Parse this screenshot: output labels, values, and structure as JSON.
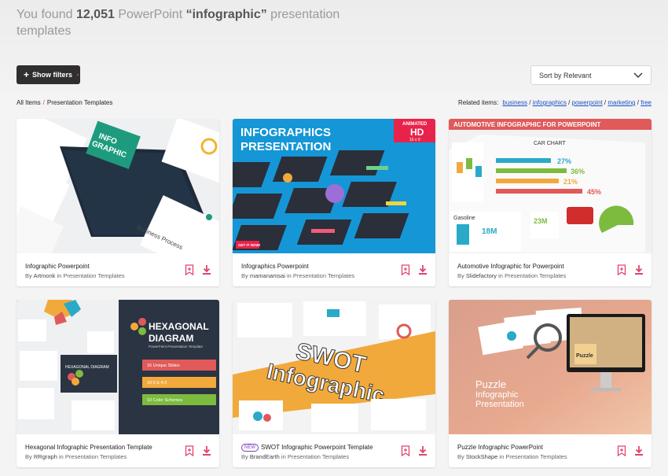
{
  "header": {
    "prefix": "You found",
    "count": "12,051",
    "mid": "PowerPoint",
    "query": "“infographic”",
    "suffix": "presentation templates"
  },
  "toolbar": {
    "filters_label": "Show filters",
    "sort_label": "Sort by Relevant"
  },
  "breadcrumb": {
    "root": "All Items",
    "separator": "/",
    "current": "Presentation Templates"
  },
  "related": {
    "label": "Related items:",
    "items": [
      "business",
      "infographics",
      "powerpoint",
      "marketing",
      "free"
    ],
    "separator": "/"
  },
  "cards": [
    {
      "title": "Infographic Powerpoint",
      "author": "Artmonk",
      "category": "Presentation Templates",
      "thumb_text": [
        "INFO",
        "GRAPHIC",
        "Business Process"
      ]
    },
    {
      "title": "Infographics Powerpoint",
      "author": "mamanamsai",
      "category": "Presentation Templates",
      "thumb_text": [
        "INFOGRAPHICS",
        "PRESENTATION",
        "ANIMATED",
        "HD",
        "16 x 9",
        "GET IT NOW!"
      ]
    },
    {
      "title": "Automotive Infographic for Powerpoint",
      "author": "Slidefactory",
      "category": "Presentation Templates",
      "thumb_text": [
        "AUTOMOTIVE INFOGRAPHIC FOR POWERPOINT",
        "CAR CHART",
        "27%",
        "36%",
        "21%",
        "45%",
        "18M",
        "23M",
        "Gasoline"
      ]
    },
    {
      "title": "Hexagonal Infographic Presentation Template",
      "author": "RRgraph",
      "category": "Presentation Templates",
      "thumb_text": [
        "HEXAGONAL",
        "DIAGRAM",
        "PowerPoint Presentation Template",
        "16 Unique Slides",
        "16:9 & 4:3",
        "10 Color Schemes"
      ]
    },
    {
      "title": "SWOT Infographic Powerpoint Template",
      "author": "BrandEarth",
      "category": "Presentation Templates",
      "badge": "NEW",
      "thumb_text": [
        "SWOT",
        "Infographic"
      ]
    },
    {
      "title": "Puzzle Infographic PowerPoint",
      "author": "StockShape",
      "category": "Presentation Templates",
      "thumb_text": [
        "Puzzle",
        "Infographic",
        "Presentation"
      ]
    }
  ],
  "card_meta": {
    "by": "By",
    "in": "in"
  },
  "colors": {
    "accent": "#e0436b",
    "link": "#1a52c4",
    "dark_button": "#2f2f2f"
  },
  "icons": {
    "bookmark": "bookmark-add-icon",
    "download": "download-icon",
    "sort": "chevron-down-icon"
  }
}
